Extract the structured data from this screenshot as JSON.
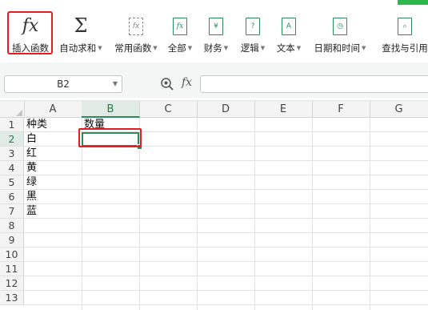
{
  "ribbon": {
    "insert_function": {
      "label": "插入函数",
      "icon": "fx-icon"
    },
    "buttons": [
      {
        "label": "自动求和",
        "icon": "sigma-icon"
      },
      {
        "label": "常用函数",
        "icon": "common-function-icon"
      },
      {
        "label": "全部",
        "icon": "fx-book-icon"
      },
      {
        "label": "财务",
        "icon": "finance-book-icon"
      },
      {
        "label": "逻辑",
        "icon": "logic-book-icon"
      },
      {
        "label": "文本",
        "icon": "text-book-icon"
      },
      {
        "label": "日期和时间",
        "icon": "clock-book-icon"
      },
      {
        "label": "查找与引用",
        "icon": "lookup-book-icon"
      }
    ]
  },
  "formula_bar": {
    "name_box": "B2",
    "fx_label": "fx",
    "formula": ""
  },
  "sheet": {
    "columns": [
      "A",
      "B",
      "C",
      "D",
      "E",
      "F",
      "G"
    ],
    "rows": [
      "1",
      "2",
      "3",
      "4",
      "5",
      "6",
      "7",
      "8",
      "9",
      "10",
      "11",
      "12",
      "13"
    ],
    "selected_column": "B",
    "selected_row": "2",
    "cells": {
      "A1": "种类",
      "B1": "数量",
      "A2": "白",
      "A3": "红",
      "A4": "黄",
      "A5": "绿",
      "A6": "黑",
      "A7": "蓝"
    }
  },
  "colors": {
    "accent": "#2e8a56",
    "highlight": "#e02020"
  }
}
